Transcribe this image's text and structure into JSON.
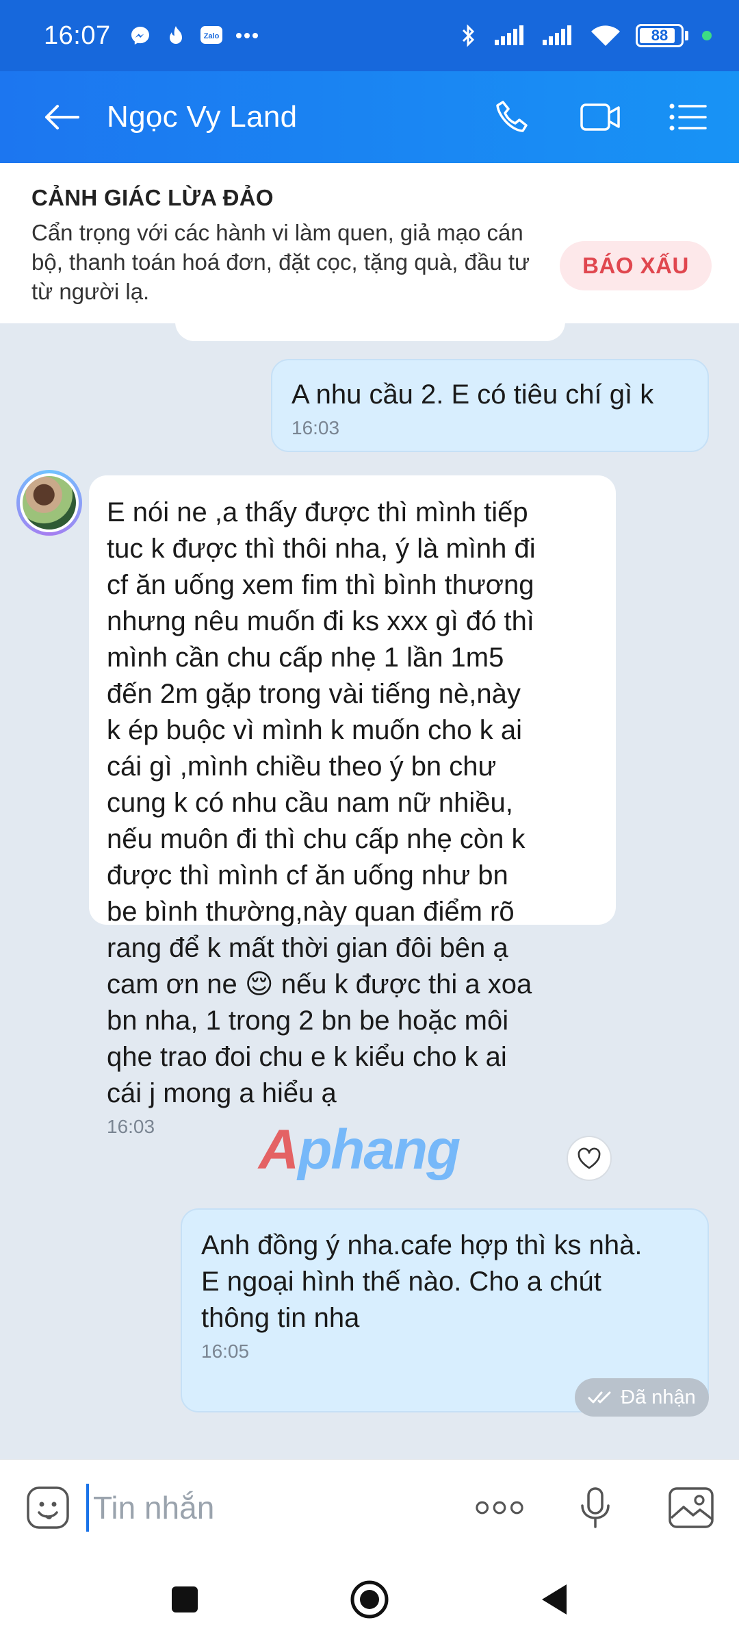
{
  "status_bar": {
    "time": "16:07",
    "battery": "88",
    "icons": [
      "messenger-icon",
      "fire-icon",
      "zalo-icon",
      "more-dots-icon",
      "bluetooth-icon",
      "signal-icon",
      "signal-icon",
      "wifi-icon",
      "battery-icon"
    ]
  },
  "header": {
    "title": "Ngọc Vy Land",
    "actions": [
      "phone-icon",
      "video-call-icon",
      "menu-list-icon"
    ]
  },
  "warning": {
    "title": "CẢNH GIÁC LỪA ĐẢO",
    "body": "Cẩn trọng với các hành vi làm quen, giả mạo cán bộ, thanh toán hoá đơn, đặt cọc, tặng quà, đầu tư từ người lạ.",
    "report_label": "BÁO XẤU",
    "report_color": "#e0474f"
  },
  "messages": [
    {
      "direction": "out",
      "text": "A nhu cầu 2. E có tiêu chí gì k",
      "time": "16:03"
    },
    {
      "direction": "in",
      "lines": [
        "E nói ne ,a thấy được thì mình tiếp",
        "tuc k được  thì thôi nha, ý là mình đi",
        "cf ăn uống  xem fim thì bình thương",
        "nhưng  nêu muốn đi ks xxx gì đó thì",
        "mình cần chu cấp nhẹ 1 lần 1m5",
        "đến 2m gặp  trong  vài  tiếng  nè,này",
        "k ép buộc  vì mình k muốn cho k ai",
        "cái gì ,mình chiều  theo  ý bn chư",
        "cung  k có nhu cầu nam nữ  nhiều,",
        "nếu muôn đi thì  chu cấp nhẹ còn k",
        "được  thì mình cf ăn uống như bn",
        "be bình thường,này quan điểm rõ",
        "rang để k mất thời gian đôi bên ạ",
        "cam ơn ne",
        "bn nha, 1 trong  2 bn be hoặc môi",
        "qhe trao đoi  chu e k kiểu  cho k ai",
        "cái j mong  a hiểu ạ"
      ],
      "line14_suffix": "nếu k được thi  a xoa",
      "emoji": "😌",
      "time": "16:03"
    },
    {
      "direction": "out",
      "lines": [
        "Anh đồng ý nha.cafe hợp thì ks nhà.",
        "E ngoại hình thế nào. Cho a chút",
        "thông tin nha"
      ],
      "time": "16:05"
    }
  ],
  "received_status": "Đã nhận",
  "watermark": {
    "accent": "A",
    "rest": "phang"
  },
  "input": {
    "placeholder": "Tin nhắn",
    "value": ""
  },
  "colors": {
    "header": "#1c76f0",
    "outgoing_bubble": "#d8eefe",
    "incoming_bubble": "#ffffff",
    "chat_background": "#e2e9f1"
  }
}
